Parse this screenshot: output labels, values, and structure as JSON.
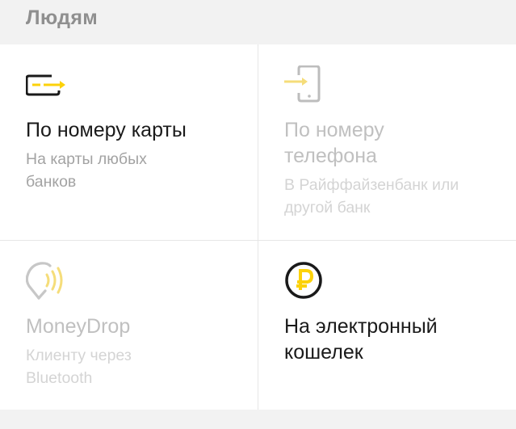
{
  "section": {
    "title": "Людям"
  },
  "options": [
    {
      "title": "По номеру карты",
      "subtitle": "На карты любых банков",
      "icon": "card-transfer-icon"
    },
    {
      "title": "По номеру телефона",
      "subtitle": "В Райффайзенбанк или другой банк",
      "icon": "phone-transfer-icon"
    },
    {
      "title": "MoneyDrop",
      "subtitle": "Клиенту через Bluetooth",
      "icon": "moneydrop-icon"
    },
    {
      "title": "На электронный кошелек",
      "subtitle": "",
      "icon": "ruble-wallet-icon"
    }
  ],
  "colors": {
    "accent": "#fcd20a",
    "text": "#1a1a1a",
    "disabled": "#c0c0c0",
    "background": "#f2f2f2"
  }
}
